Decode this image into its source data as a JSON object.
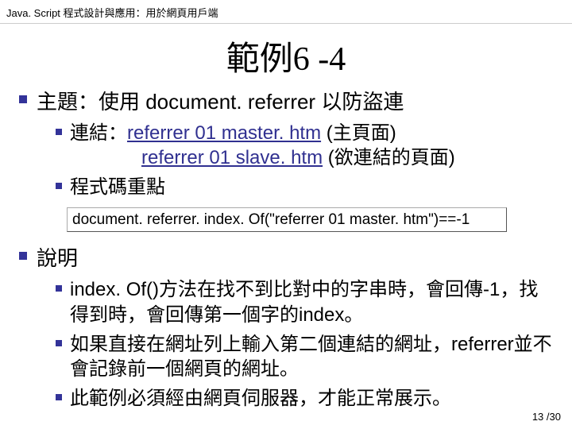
{
  "header": "Java. Script 程式設計與應用：用於網頁用戶端",
  "title": "範例6 -4",
  "main": {
    "topic_label": "主題：使用 document. referrer 以防盜連",
    "link_prefix": "連結：",
    "link1_text": "referrer 01 master. htm",
    "link1_note": " (主頁面)",
    "link2_text": "referrer 01 slave. htm",
    "link2_note": " (欲連結的頁面)",
    "code_label": "程式碼重點",
    "code_text": "document. referrer. index. Of(\"referrer 01 master. htm\")==-1",
    "explain_label": "說明",
    "explain_items": [
      "index. Of()方法在找不到比對中的字串時，會回傳-1，找得到時，會回傳第一個字的index。",
      "如果直接在網址列上輸入第二個連結的網址，referrer並不會記錄前一個網頁的網址。",
      "此範例必須經由網頁伺服器，才能正常展示。"
    ]
  },
  "page": {
    "current": "13",
    "sep": " /",
    "total": "30"
  }
}
